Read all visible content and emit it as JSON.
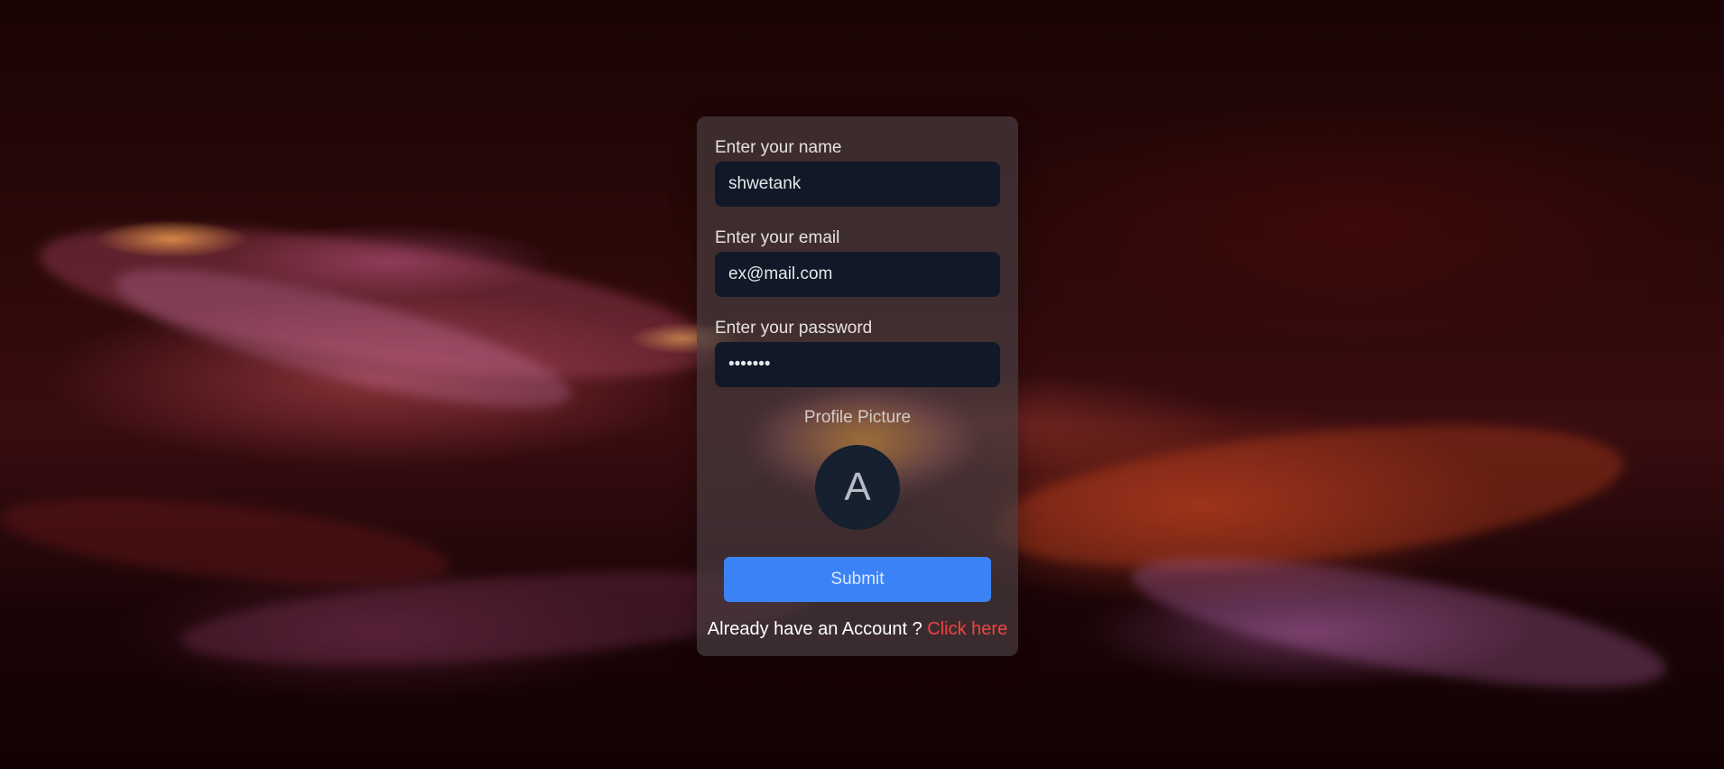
{
  "form": {
    "name_label": "Enter your name",
    "name_value": "shwetank",
    "email_label": "Enter your email",
    "email_value": "ex@mail.com",
    "password_label": "Enter your password",
    "password_value": "•••••••",
    "profile_label": "Profile Picture",
    "avatar_initial": "A",
    "submit_label": "Submit"
  },
  "footer": {
    "prompt": "Already have an Account ?",
    "link": "Click here"
  },
  "colors": {
    "input_bg": "#111827",
    "submit_bg": "#3b82f6",
    "link": "#ef4444"
  }
}
